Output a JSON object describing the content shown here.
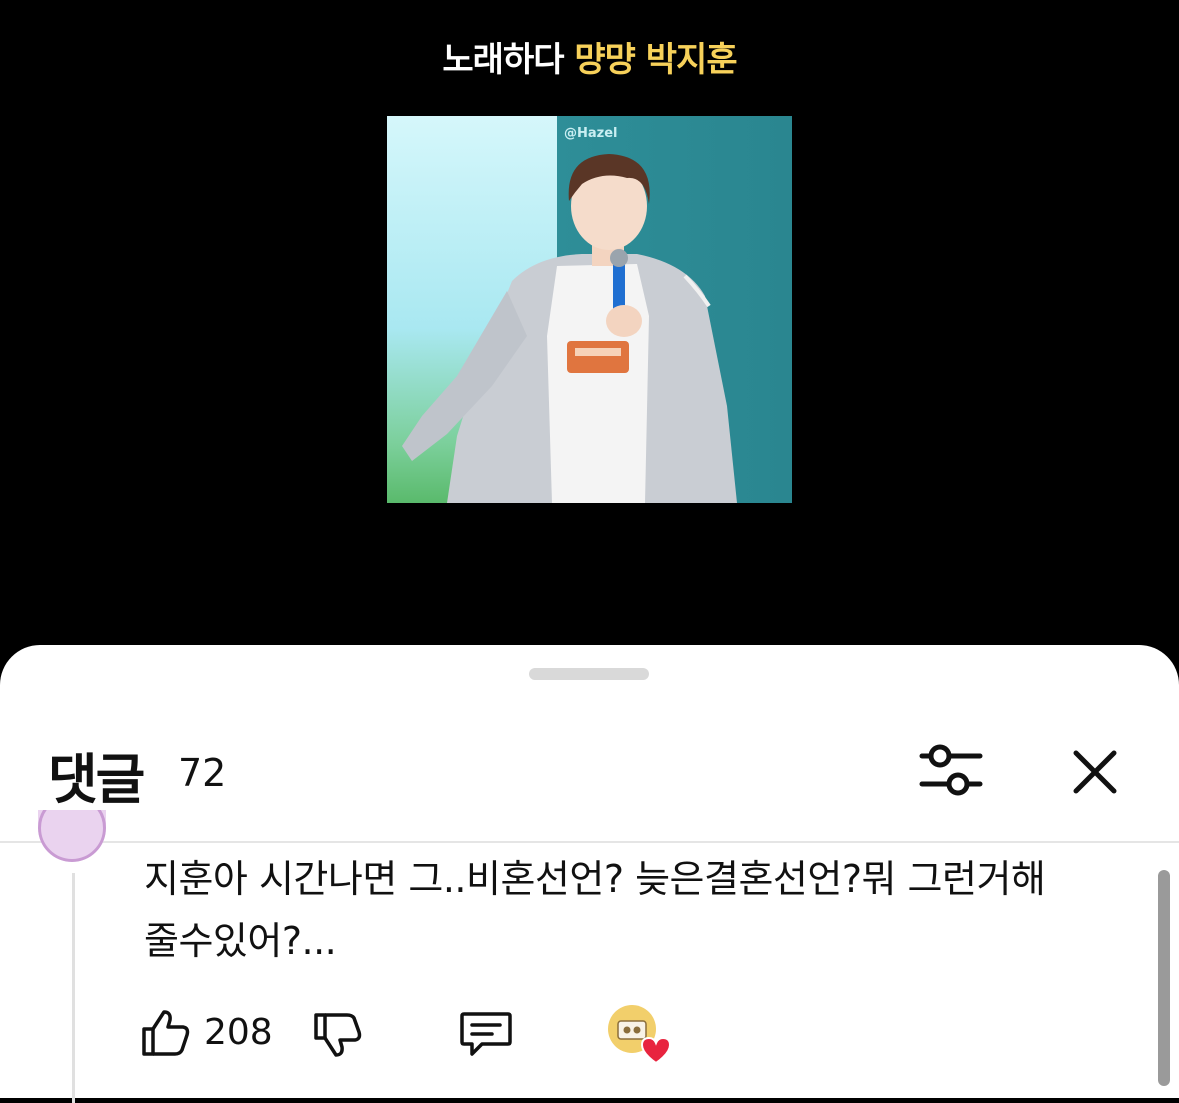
{
  "video": {
    "title_prefix": "노래하다",
    "title_highlight": "먕먕 박지훈",
    "watermark": "@Hazel",
    "highlight_color": "#f7d15a"
  },
  "comments_panel": {
    "title": "댓글",
    "count": "72",
    "filter_icon": "sliders-icon",
    "close_icon": "close-icon"
  },
  "comment": {
    "text_line1": "지훈아 시간나면 그..비혼선언? 늦은결혼선언?뭐 그런거해",
    "text_line2": "줄수있어?...",
    "like_count": "208",
    "like_icon": "thumbs-up-icon",
    "dislike_icon": "thumbs-down-icon",
    "reply_icon": "reply-icon",
    "creator_heart_icon": "creator-heart-icon",
    "heart_color": "#e8243f"
  }
}
